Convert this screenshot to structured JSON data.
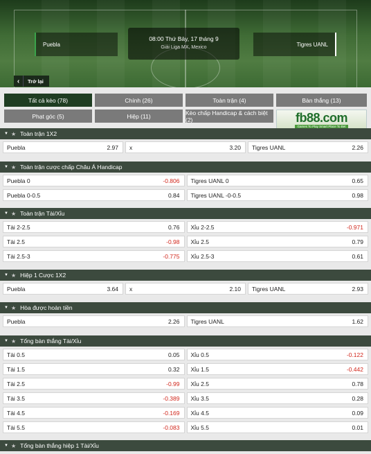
{
  "header": {
    "home_team": "Puebla",
    "away_team": "Tigres UANL",
    "datetime": "08:00 Thứ Bảy, 17 tháng 9",
    "league": "Giải Liga MX, Mexico",
    "back_label": "Trở lại"
  },
  "tabs": [
    {
      "label": "Tất cả kèo (78)",
      "active": true
    },
    {
      "label": "Chính (26)"
    },
    {
      "label": "Toàn trận (4)"
    },
    {
      "label": "Bàn thắng (13)"
    },
    {
      "label": "Phạt góc (5)"
    },
    {
      "label": "Hiệp (11)"
    },
    {
      "label": "Kèo chấp Handicap & cách biệt (2)"
    }
  ],
  "banner": {
    "logo": "fb88.com",
    "tagline": "Games To Play  Smart Place To Bet"
  },
  "sections": [
    {
      "title": "Toàn trận 1X2",
      "rows": [
        [
          {
            "label": "Puebla",
            "odd": "2.97"
          },
          {
            "label": "x",
            "odd": "3.20"
          },
          {
            "label": "Tigres UANL",
            "odd": "2.26"
          }
        ]
      ]
    },
    {
      "title": "Toàn trận cược chấp Châu Á Handicap",
      "rows": [
        [
          {
            "label": "Puebla 0",
            "odd": "-0.806"
          },
          {
            "label": "Tigres UANL 0",
            "odd": "0.65"
          }
        ],
        [
          {
            "label": "Puebla 0-0.5",
            "odd": "0.84"
          },
          {
            "label": "Tigres UANL -0-0.5",
            "odd": "0.98"
          }
        ]
      ]
    },
    {
      "title": "Toàn trận Tài/Xỉu",
      "rows": [
        [
          {
            "label": "Tài 2-2.5",
            "odd": "0.76"
          },
          {
            "label": "Xỉu 2-2.5",
            "odd": "-0.971"
          }
        ],
        [
          {
            "label": "Tài 2.5",
            "odd": "-0.98"
          },
          {
            "label": "Xỉu 2.5",
            "odd": "0.79"
          }
        ],
        [
          {
            "label": "Tài 2.5-3",
            "odd": "-0.775"
          },
          {
            "label": "Xỉu 2.5-3",
            "odd": "0.61"
          }
        ]
      ]
    },
    {
      "title": "Hiệp 1 Cược 1X2",
      "rows": [
        [
          {
            "label": "Puebla",
            "odd": "3.64"
          },
          {
            "label": "x",
            "odd": "2.10"
          },
          {
            "label": "Tigres UANL",
            "odd": "2.93"
          }
        ]
      ]
    },
    {
      "title": "Hòa được hoàn tiền",
      "rows": [
        [
          {
            "label": "Puebla",
            "odd": "2.26"
          },
          {
            "label": "Tigres UANL",
            "odd": "1.62"
          }
        ]
      ]
    },
    {
      "title": "Tổng bàn thắng Tài/Xỉu",
      "rows": [
        [
          {
            "label": "Tài 0.5",
            "odd": "0.05"
          },
          {
            "label": "Xỉu 0.5",
            "odd": "-0.122"
          }
        ],
        [
          {
            "label": "Tài 1.5",
            "odd": "0.32"
          },
          {
            "label": "Xỉu 1.5",
            "odd": "-0.442"
          }
        ],
        [
          {
            "label": "Tài 2.5",
            "odd": "-0.99"
          },
          {
            "label": "Xỉu 2.5",
            "odd": "0.78"
          }
        ],
        [
          {
            "label": "Tài 3.5",
            "odd": "-0.389"
          },
          {
            "label": "Xỉu 3.5",
            "odd": "0.28"
          }
        ],
        [
          {
            "label": "Tài 4.5",
            "odd": "-0.169"
          },
          {
            "label": "Xỉu 4.5",
            "odd": "0.09"
          }
        ],
        [
          {
            "label": "Tài 5.5",
            "odd": "-0.083"
          },
          {
            "label": "Xỉu 5.5",
            "odd": "0.01"
          }
        ]
      ]
    },
    {
      "title": "Tổng bàn thắng hiệp 1 Tài/Xỉu",
      "rows": []
    }
  ],
  "colors": {
    "section_bg": "#3c4a3e",
    "active_tab": "#1f3d22",
    "tab": "#7a7a7a",
    "negative": "#d1261b"
  }
}
